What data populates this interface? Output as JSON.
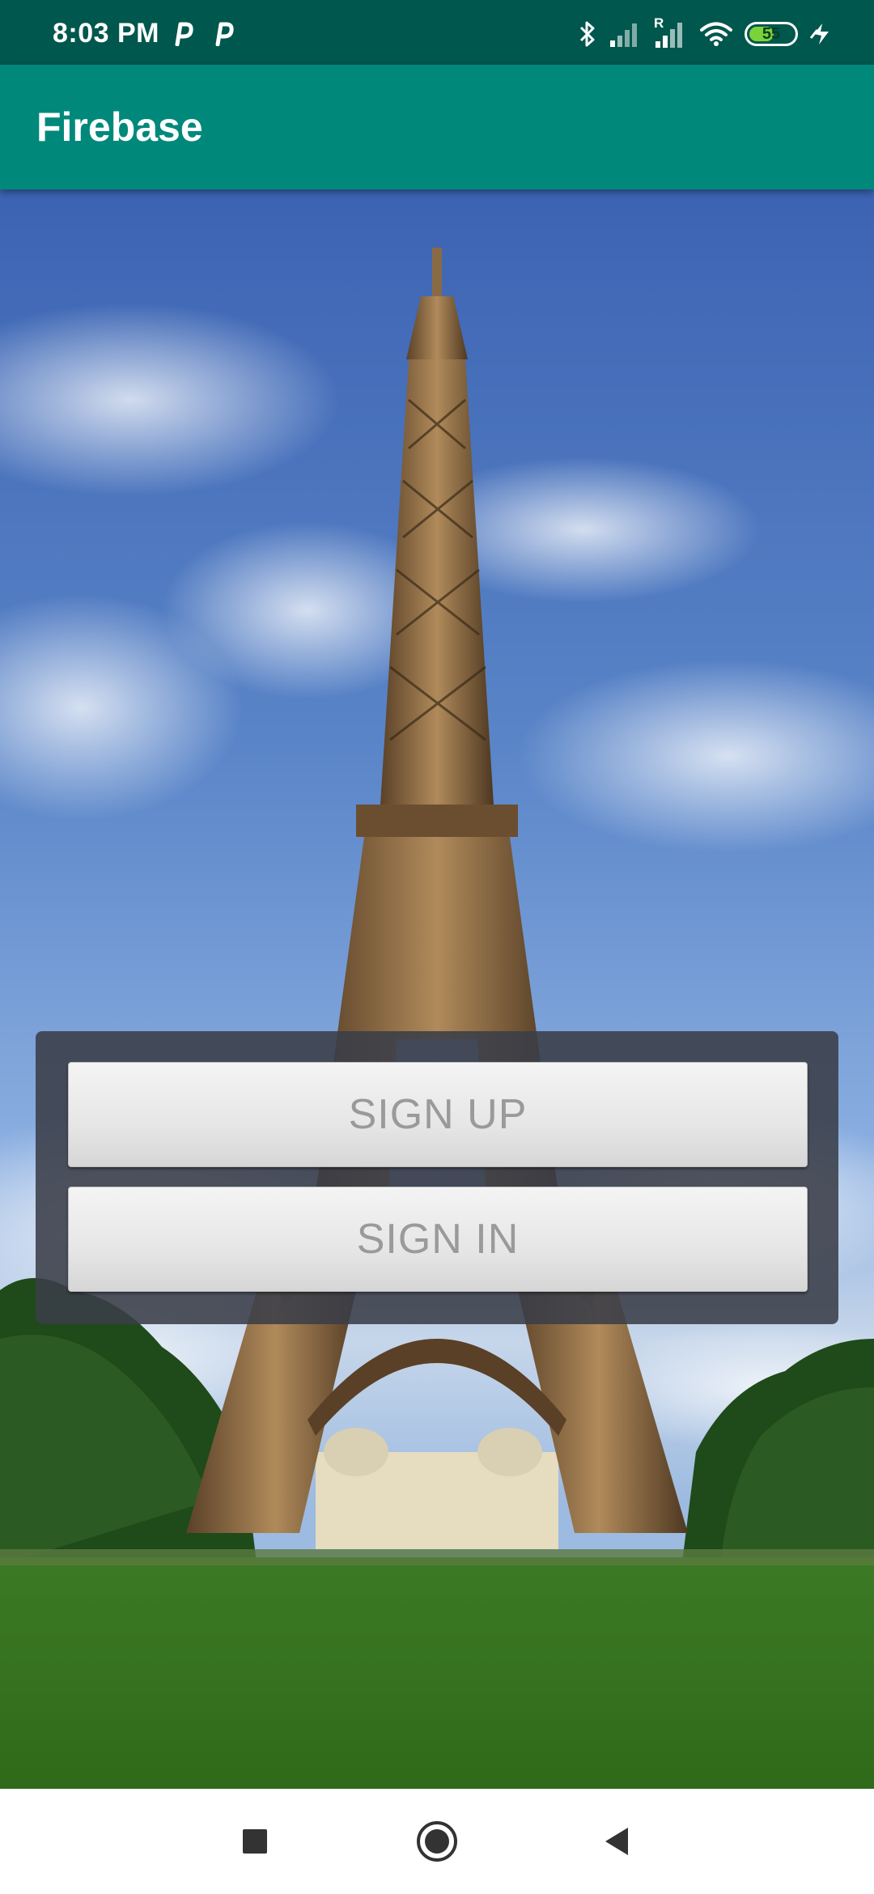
{
  "status_bar": {
    "time": "8:03 PM",
    "notification_icons": [
      "p-app-icon",
      "p-app-icon"
    ],
    "system_icons": [
      "bluetooth-icon",
      "signal-icon",
      "signal-roaming-icon",
      "wifi-icon",
      "battery-icon",
      "charging-icon"
    ],
    "roaming_label": "R",
    "battery_level": "55",
    "battery_fraction": 0.55,
    "background_color": "#00574d"
  },
  "app_bar": {
    "title": "Firebase",
    "background_color": "#00897b"
  },
  "background_image": {
    "subject": "Eiffel Tower under blue sky with green lawn"
  },
  "auth_panel": {
    "sign_up_label": "SIGN UP",
    "sign_in_label": "SIGN IN"
  },
  "nav_bar": {
    "buttons": [
      "recent-apps-icon",
      "home-icon",
      "back-icon"
    ]
  }
}
